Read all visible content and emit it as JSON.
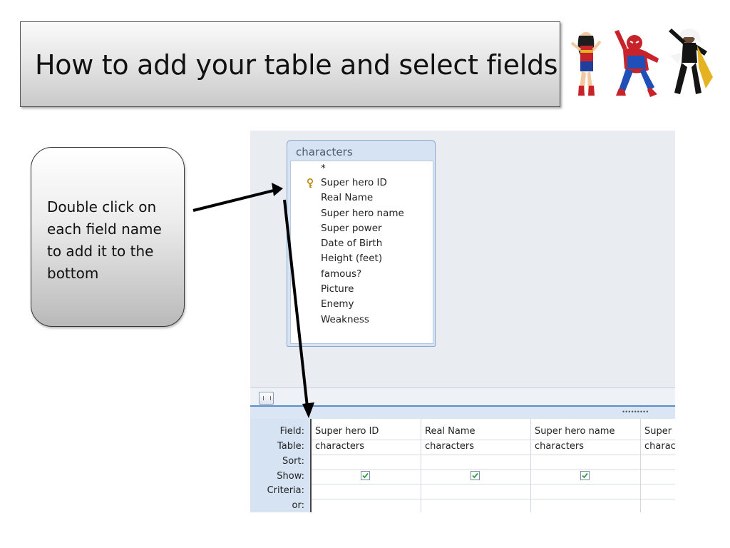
{
  "slide": {
    "title": "How to add your table and select fields",
    "callout_text": "Double click on each field name to add it to the bottom"
  },
  "table_window": {
    "title": "characters",
    "fields": [
      "*",
      "Super hero ID",
      "Real Name",
      "Super hero name",
      "Super power",
      "Date of Birth",
      "Height (feet)",
      "famous?",
      "Picture",
      "Enemy",
      "Weakness"
    ],
    "primary_key_field": "Super hero ID"
  },
  "design_grid": {
    "row_labels": [
      "Field:",
      "Table:",
      "Sort:",
      "Show:",
      "Criteria:",
      "or:"
    ],
    "columns": [
      {
        "field": "Super hero ID",
        "table": "characters",
        "show": true
      },
      {
        "field": "Real Name",
        "table": "characters",
        "show": true
      },
      {
        "field": "Super hero name",
        "table": "characters",
        "show": true
      },
      {
        "field": "Super",
        "table": "charac",
        "show": false
      }
    ]
  },
  "icons": [
    "key-icon",
    "checkbox-checked-icon",
    "scroll-grip-icon",
    "arrow-icon",
    "superhero-images"
  ],
  "colors": {
    "grid_accent": "#5b8dc9",
    "checkmark": "#2e9e3a",
    "window_border": "#8aa7cf"
  }
}
